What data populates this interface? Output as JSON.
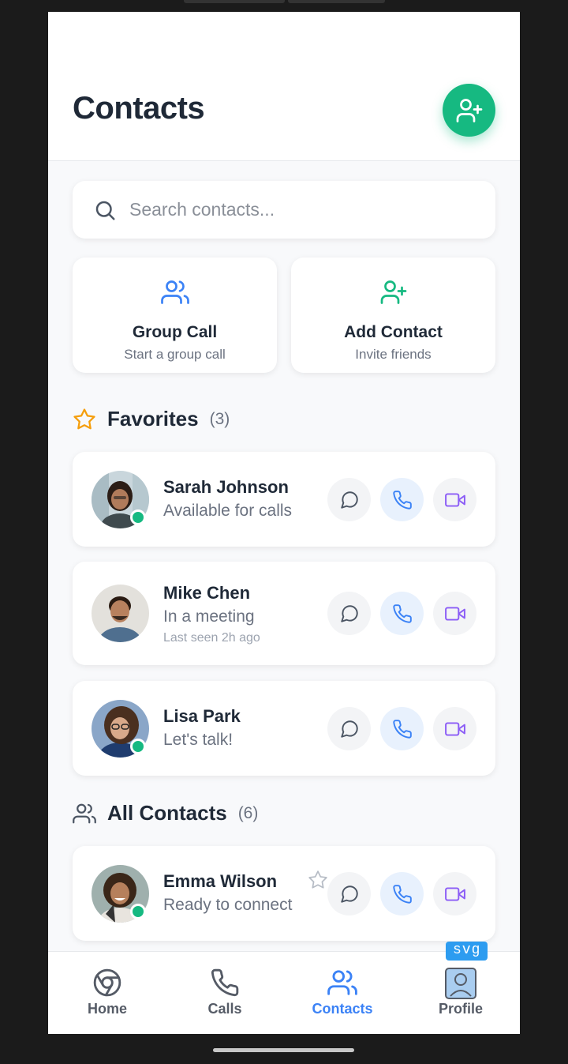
{
  "header": {
    "title": "Contacts",
    "add_icon": "user-plus-icon"
  },
  "search": {
    "placeholder": "Search contacts...",
    "icon": "search-icon"
  },
  "actions": [
    {
      "title": "Group Call",
      "subtitle": "Start a group call",
      "icon": "users-icon",
      "color": "#3b82f6"
    },
    {
      "title": "Add Contact",
      "subtitle": "Invite friends",
      "icon": "user-plus-icon",
      "color": "#16b981"
    }
  ],
  "favorites": {
    "title": "Favorites",
    "count": "(3)",
    "icon": "star-icon",
    "items": [
      {
        "name": "Sarah Johnson",
        "status": "Available for calls",
        "last_seen": "",
        "online": true
      },
      {
        "name": "Mike Chen",
        "status": "In a meeting",
        "last_seen": "Last seen 2h ago",
        "online": false
      },
      {
        "name": "Lisa Park",
        "status": "Let's talk!",
        "last_seen": "",
        "online": true
      }
    ]
  },
  "all_contacts": {
    "title": "All Contacts",
    "count": "(6)",
    "icon": "users-icon",
    "items": [
      {
        "name": "Emma Wilson",
        "status": "Ready to connect",
        "last_seen": "",
        "online": true
      }
    ]
  },
  "tabs": [
    {
      "label": "Home",
      "icon": "chrome-icon",
      "active": false
    },
    {
      "label": "Calls",
      "icon": "phone-icon",
      "active": false
    },
    {
      "label": "Contacts",
      "icon": "users-icon",
      "active": true
    },
    {
      "label": "Profile",
      "icon": "user-avatar-icon",
      "active": false
    }
  ],
  "badge": {
    "label": "svg"
  },
  "colors": {
    "accent": "#3b82f6",
    "green": "#16b981",
    "video": "#8b5cf6",
    "star": "#f59e0b"
  }
}
